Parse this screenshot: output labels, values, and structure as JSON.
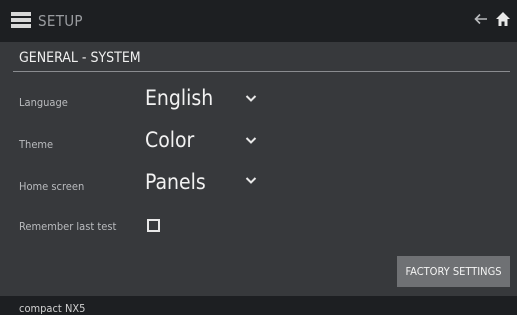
{
  "header": {
    "title": "SETUP",
    "menu_icon": "hamburger-menu-icon",
    "back_icon": "back-arrow-icon",
    "home_icon": "home-icon"
  },
  "section": {
    "title": "GENERAL - SYSTEM"
  },
  "settings": {
    "language": {
      "label": "Language",
      "value": "English"
    },
    "theme": {
      "label": "Theme",
      "value": "Color"
    },
    "home_screen": {
      "label": "Home screen",
      "value": "Panels"
    },
    "remember_last_test": {
      "label": "Remember last test",
      "checked": false
    }
  },
  "actions": {
    "factory_settings": "FACTORY SETTINGS"
  },
  "footer": {
    "device_name": "compact NX5"
  },
  "colors": {
    "background": "#37393c",
    "bar": "#1d1f22",
    "button": "#6f7174"
  }
}
